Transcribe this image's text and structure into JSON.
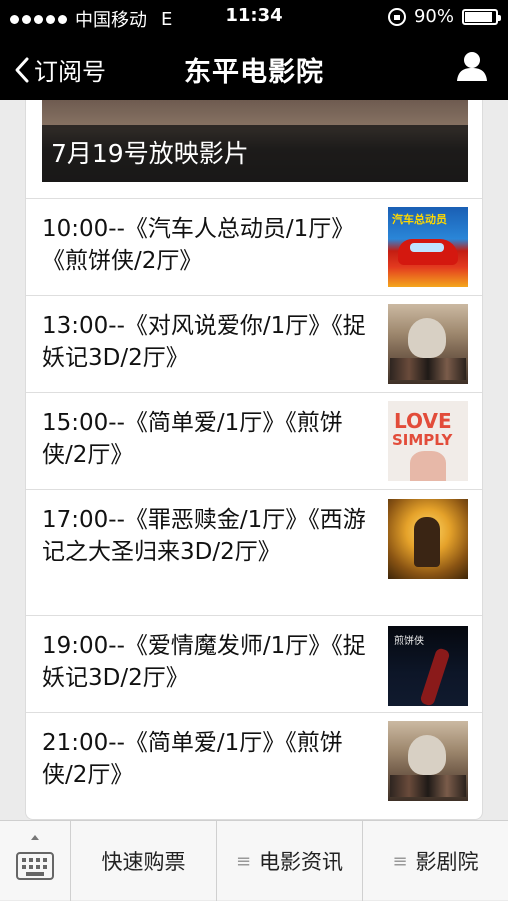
{
  "status_bar": {
    "carrier": "中国移动",
    "network": "E",
    "time": "11:34",
    "battery": "90%",
    "battery_level": 0.9
  },
  "nav": {
    "back_label": "订阅号",
    "title": "东平电影院"
  },
  "banner": {
    "caption": "7月19号放映影片"
  },
  "schedule": [
    {
      "text": "10:00--《汽车人总动员/1厅》《煎饼侠/2厅》",
      "poster_title": "汽车总动员"
    },
    {
      "text": "13:00--《对风说爱你/1厅》《捉妖记3D/2厅》"
    },
    {
      "text": "15:00--《简单爱/1厅》《煎饼侠/2厅》",
      "poster_title_1": "LOVE",
      "poster_title_2": "SIMPLY"
    },
    {
      "text": "17:00--《罪恶赎金/1厅》《西游记之大圣归来3D/2厅》"
    },
    {
      "text": "19:00--《爱情魔发师/1厅》《捉妖记3D/2厅》",
      "poster_title": "煎饼侠"
    },
    {
      "text": "21:00--《简单爱/1厅》《煎饼侠/2厅》"
    }
  ],
  "tabbar": {
    "tab1": "快速购票",
    "tab2": "电影资讯",
    "tab3": "影剧院"
  }
}
